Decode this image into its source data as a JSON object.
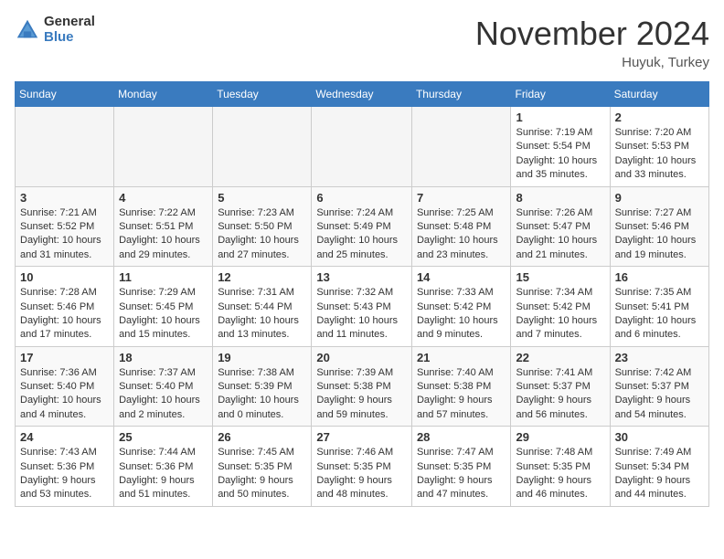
{
  "logo": {
    "general": "General",
    "blue": "Blue"
  },
  "header": {
    "title": "November 2024",
    "location": "Huyuk, Turkey"
  },
  "days_of_week": [
    "Sunday",
    "Monday",
    "Tuesday",
    "Wednesday",
    "Thursday",
    "Friday",
    "Saturday"
  ],
  "weeks": [
    [
      {
        "day": "",
        "info": ""
      },
      {
        "day": "",
        "info": ""
      },
      {
        "day": "",
        "info": ""
      },
      {
        "day": "",
        "info": ""
      },
      {
        "day": "",
        "info": ""
      },
      {
        "day": "1",
        "info": "Sunrise: 7:19 AM\nSunset: 5:54 PM\nDaylight: 10 hours and 35 minutes."
      },
      {
        "day": "2",
        "info": "Sunrise: 7:20 AM\nSunset: 5:53 PM\nDaylight: 10 hours and 33 minutes."
      }
    ],
    [
      {
        "day": "3",
        "info": "Sunrise: 7:21 AM\nSunset: 5:52 PM\nDaylight: 10 hours and 31 minutes."
      },
      {
        "day": "4",
        "info": "Sunrise: 7:22 AM\nSunset: 5:51 PM\nDaylight: 10 hours and 29 minutes."
      },
      {
        "day": "5",
        "info": "Sunrise: 7:23 AM\nSunset: 5:50 PM\nDaylight: 10 hours and 27 minutes."
      },
      {
        "day": "6",
        "info": "Sunrise: 7:24 AM\nSunset: 5:49 PM\nDaylight: 10 hours and 25 minutes."
      },
      {
        "day": "7",
        "info": "Sunrise: 7:25 AM\nSunset: 5:48 PM\nDaylight: 10 hours and 23 minutes."
      },
      {
        "day": "8",
        "info": "Sunrise: 7:26 AM\nSunset: 5:47 PM\nDaylight: 10 hours and 21 minutes."
      },
      {
        "day": "9",
        "info": "Sunrise: 7:27 AM\nSunset: 5:46 PM\nDaylight: 10 hours and 19 minutes."
      }
    ],
    [
      {
        "day": "10",
        "info": "Sunrise: 7:28 AM\nSunset: 5:46 PM\nDaylight: 10 hours and 17 minutes."
      },
      {
        "day": "11",
        "info": "Sunrise: 7:29 AM\nSunset: 5:45 PM\nDaylight: 10 hours and 15 minutes."
      },
      {
        "day": "12",
        "info": "Sunrise: 7:31 AM\nSunset: 5:44 PM\nDaylight: 10 hours and 13 minutes."
      },
      {
        "day": "13",
        "info": "Sunrise: 7:32 AM\nSunset: 5:43 PM\nDaylight: 10 hours and 11 minutes."
      },
      {
        "day": "14",
        "info": "Sunrise: 7:33 AM\nSunset: 5:42 PM\nDaylight: 10 hours and 9 minutes."
      },
      {
        "day": "15",
        "info": "Sunrise: 7:34 AM\nSunset: 5:42 PM\nDaylight: 10 hours and 7 minutes."
      },
      {
        "day": "16",
        "info": "Sunrise: 7:35 AM\nSunset: 5:41 PM\nDaylight: 10 hours and 6 minutes."
      }
    ],
    [
      {
        "day": "17",
        "info": "Sunrise: 7:36 AM\nSunset: 5:40 PM\nDaylight: 10 hours and 4 minutes."
      },
      {
        "day": "18",
        "info": "Sunrise: 7:37 AM\nSunset: 5:40 PM\nDaylight: 10 hours and 2 minutes."
      },
      {
        "day": "19",
        "info": "Sunrise: 7:38 AM\nSunset: 5:39 PM\nDaylight: 10 hours and 0 minutes."
      },
      {
        "day": "20",
        "info": "Sunrise: 7:39 AM\nSunset: 5:38 PM\nDaylight: 9 hours and 59 minutes."
      },
      {
        "day": "21",
        "info": "Sunrise: 7:40 AM\nSunset: 5:38 PM\nDaylight: 9 hours and 57 minutes."
      },
      {
        "day": "22",
        "info": "Sunrise: 7:41 AM\nSunset: 5:37 PM\nDaylight: 9 hours and 56 minutes."
      },
      {
        "day": "23",
        "info": "Sunrise: 7:42 AM\nSunset: 5:37 PM\nDaylight: 9 hours and 54 minutes."
      }
    ],
    [
      {
        "day": "24",
        "info": "Sunrise: 7:43 AM\nSunset: 5:36 PM\nDaylight: 9 hours and 53 minutes."
      },
      {
        "day": "25",
        "info": "Sunrise: 7:44 AM\nSunset: 5:36 PM\nDaylight: 9 hours and 51 minutes."
      },
      {
        "day": "26",
        "info": "Sunrise: 7:45 AM\nSunset: 5:35 PM\nDaylight: 9 hours and 50 minutes."
      },
      {
        "day": "27",
        "info": "Sunrise: 7:46 AM\nSunset: 5:35 PM\nDaylight: 9 hours and 48 minutes."
      },
      {
        "day": "28",
        "info": "Sunrise: 7:47 AM\nSunset: 5:35 PM\nDaylight: 9 hours and 47 minutes."
      },
      {
        "day": "29",
        "info": "Sunrise: 7:48 AM\nSunset: 5:35 PM\nDaylight: 9 hours and 46 minutes."
      },
      {
        "day": "30",
        "info": "Sunrise: 7:49 AM\nSunset: 5:34 PM\nDaylight: 9 hours and 44 minutes."
      }
    ]
  ]
}
